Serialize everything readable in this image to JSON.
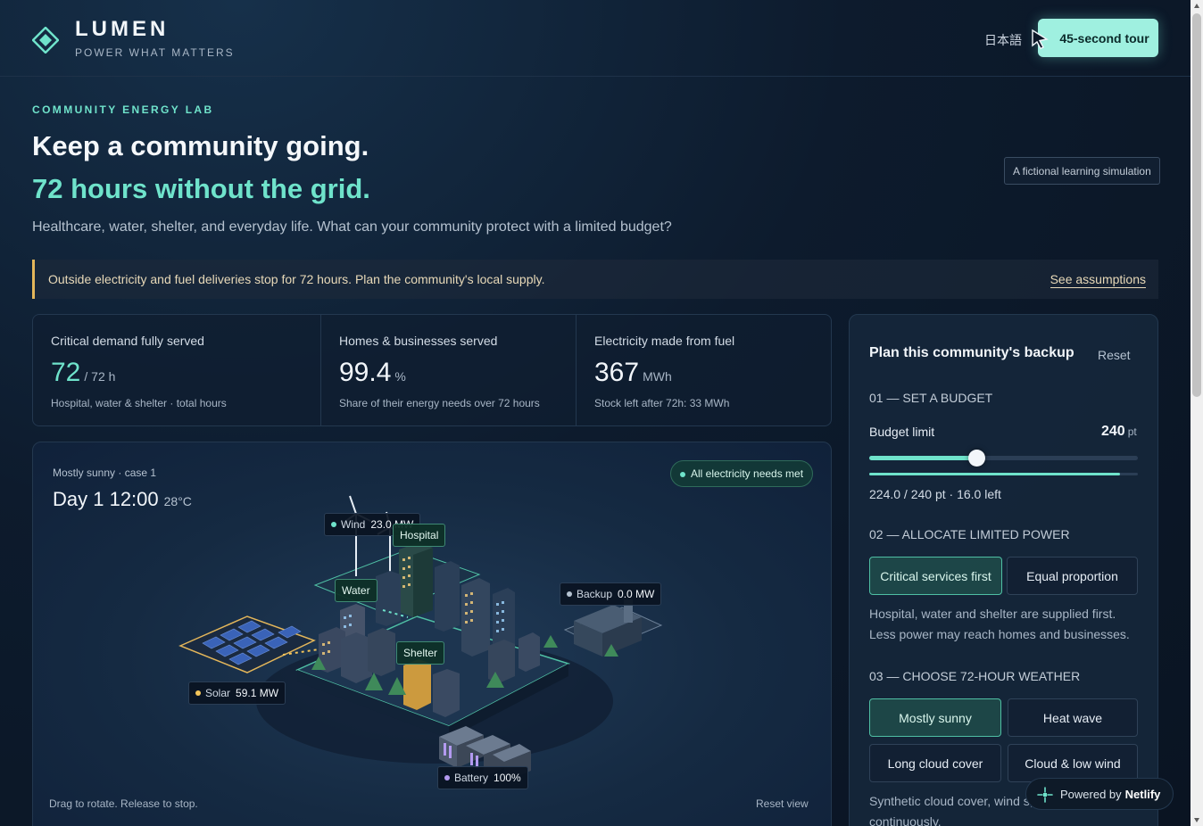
{
  "header": {
    "brand": "LUMEN",
    "tagline": "POWER WHAT MATTERS",
    "language": "日本語",
    "tour_button": "45-second tour"
  },
  "intro": {
    "eyebrow": "COMMUNITY ENERGY LAB",
    "title_line1": "Keep a community going.",
    "title_line2": "72 hours without the grid.",
    "lead": "Healthcare, water, shelter, and everyday life. What can your community protect with a limited budget?",
    "badge": "A fictional learning simulation"
  },
  "notice": {
    "text": "Outside electricity and fuel deliveries stop for 72 hours. Plan the community's local supply.",
    "link": "See assumptions"
  },
  "stats": [
    {
      "label": "Critical demand fully served",
      "value": "72",
      "unit": "/ 72 h",
      "sub": "Hospital, water & shelter · total hours"
    },
    {
      "label": "Homes & businesses served",
      "value": "99.4",
      "unit": "%",
      "sub": "Share of their energy needs over 72 hours"
    },
    {
      "label": "Electricity made from fuel",
      "value": "367",
      "unit": "MWh",
      "sub": "Stock left after 72h: 33 MWh"
    }
  ],
  "scene": {
    "subtitle": "Mostly sunny · case 1",
    "time": "Day 1 12:00",
    "temp": "28°C",
    "status": "All electricity needs met",
    "drag_hint": "Drag to rotate. Release to stop.",
    "reset_view": "Reset view",
    "sources": [
      {
        "name": "Wind",
        "value": "23.0 MW",
        "color": "#6fe3cb"
      },
      {
        "name": "Backup",
        "value": "0.0 MW",
        "color": "#b5c2d0"
      },
      {
        "name": "Solar",
        "value": "59.1 MW",
        "color": "#f3c55a"
      },
      {
        "name": "Battery",
        "value": "100%",
        "color": "#b39af0"
      }
    ],
    "buildings": [
      "Hospital",
      "Water",
      "Shelter"
    ]
  },
  "panel": {
    "title": "Plan this community's backup",
    "reset": "Reset",
    "step1": "01 — SET A BUDGET",
    "budget_label": "Budget limit",
    "budget_value": "240",
    "budget_unit": "pt",
    "budget_fraction": 0.4,
    "used_fraction": 0.933,
    "budget_used": "224.0 / 240 pt · 16.0 left",
    "step2": "02 — ALLOCATE LIMITED POWER",
    "alloc_options": [
      "Critical services first",
      "Equal proportion"
    ],
    "alloc_desc": "Hospital, water and shelter are supplied first. Less power may reach homes and businesses.",
    "step3": "03 — CHOOSE 72-HOUR WEATHER",
    "weather_options": [
      "Mostly sunny",
      "Heat wave",
      "Long cloud cover",
      "Cloud & low wind"
    ],
    "weather_desc": "Synthetic cloud cover, wind s, temperature vary continuously."
  },
  "netlify": {
    "prefix": "Powered by",
    "brand": "Netlify"
  },
  "colors": {
    "accent": "#6fe3cb",
    "warning": "#e3b65a",
    "background": "#0d1b2d"
  }
}
